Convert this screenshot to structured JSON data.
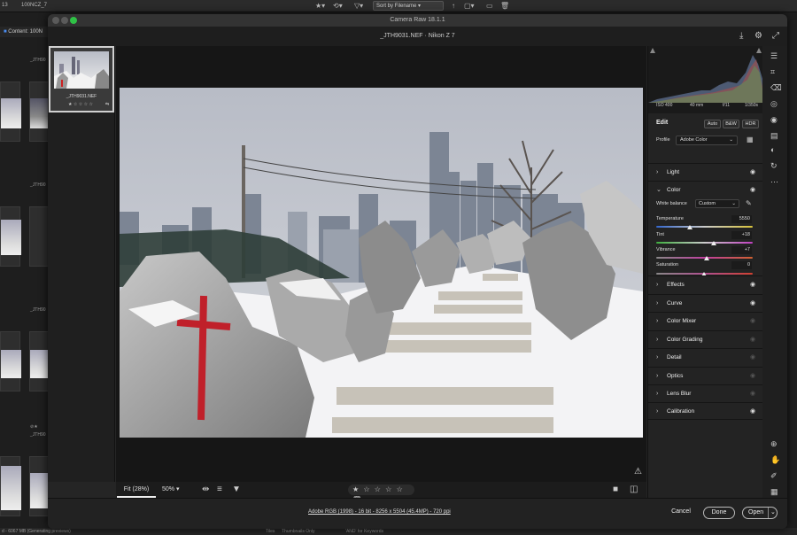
{
  "bridge": {
    "path_count": "13",
    "folder": "100NCZ_7",
    "sort_label": "Sort by Filename",
    "content_tab": "Content: 100N",
    "thumb_labels": [
      "_JTH90",
      "_JTH90",
      "_JTH90",
      "_JTH90"
    ],
    "status_text": "d - 6067 MB (Generating previews)",
    "search_keywords": "'AND' for Keywords",
    "tiles_label": "Tiles",
    "thumbs_only_label": "Thumbnails Only"
  },
  "camera_raw": {
    "window_title": "Camera Raw 18.1.1",
    "file_title": "_JTH9031.NEF  ·  Nikon Z 7",
    "filmstrip": {
      "filename": "_JTH9031.NEF",
      "stars": "★ ☆ ☆ ☆ ☆"
    },
    "canvas": {
      "zoom_fit": "Fit (28%)",
      "zoom_pct": "50%",
      "rating_stars": "★ ☆ ☆ ☆ ☆",
      "warning_icon": "warning-triangle-icon"
    },
    "workflow_options": "Adobe RGB (1998) - 16 bit - 8256 x 5504 (45.4MP) - 720 ppi",
    "buttons": {
      "cancel": "Cancel",
      "done": "Done",
      "open": "Open"
    },
    "exif": {
      "iso": "ISO 400",
      "focal": "40 mm",
      "aperture": "f/11",
      "shutter": "1/350s"
    },
    "edit": {
      "title": "Edit",
      "auto": "Auto",
      "bw": "B&W",
      "hdr": "HDR",
      "profile_label": "Profile",
      "profile_value": "Adobe Color"
    },
    "sections": {
      "light": "Light",
      "color": "Color",
      "effects": "Effects",
      "curve": "Curve",
      "color_mixer": "Color Mixer",
      "color_grading": "Color Grading",
      "detail": "Detail",
      "optics": "Optics",
      "lens_blur": "Lens Blur",
      "calibration": "Calibration"
    },
    "color": {
      "wb_label": "White balance",
      "wb_value": "Custom",
      "temperature_label": "Temperature",
      "temperature_value": "5550",
      "tint_label": "Tint",
      "tint_value": "+18",
      "vibrance_label": "Vibrance",
      "vibrance_value": "+7",
      "saturation_label": "Saturation",
      "saturation_value": "0"
    }
  }
}
